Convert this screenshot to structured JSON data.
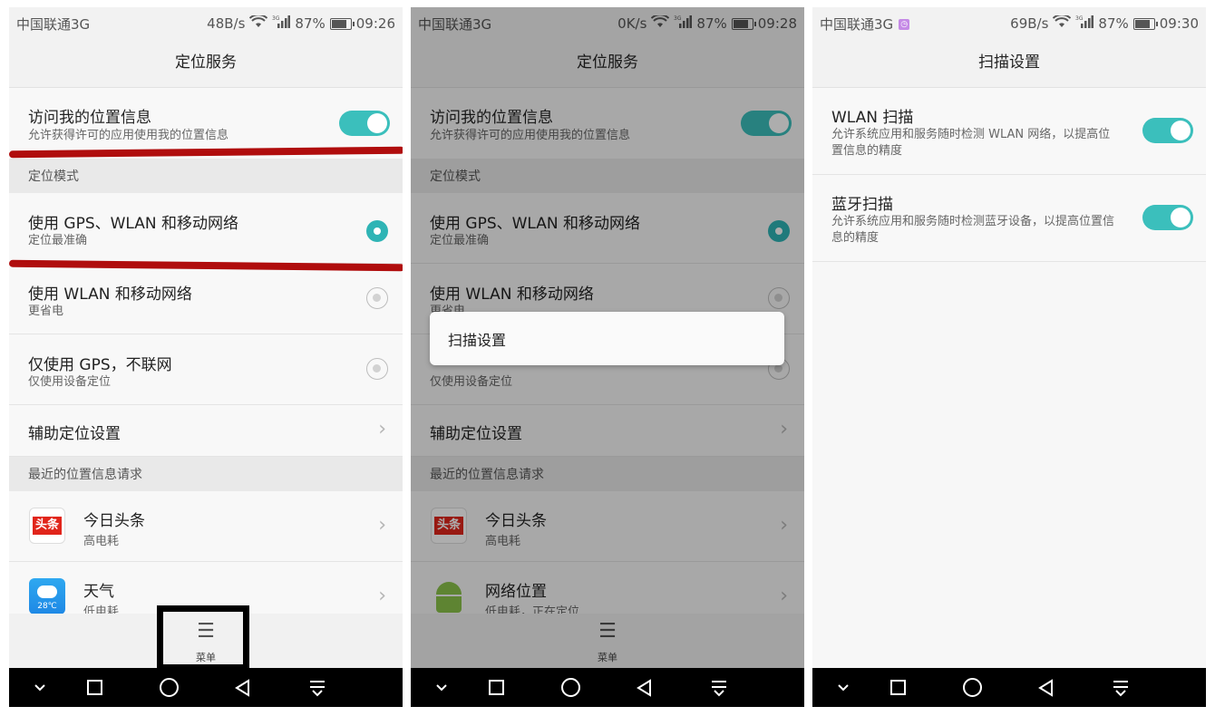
{
  "panel1": {
    "status": {
      "carrier": "中国联通3G",
      "speed": "48B/s",
      "battery": "87%",
      "time": "09:26"
    },
    "title": "定位服务",
    "access": {
      "title": "访问我的位置信息",
      "sub": "允许获得许可的应用使用我的位置信息"
    },
    "mode_section": "定位模式",
    "modes": [
      {
        "title": "使用 GPS、WLAN 和移动网络",
        "sub": "定位最准确"
      },
      {
        "title": "使用 WLAN 和移动网络",
        "sub": "更省电"
      },
      {
        "title": "仅使用 GPS，不联网",
        "sub": "仅使用设备定位"
      }
    ],
    "assist": "辅助定位设置",
    "recent_section": "最近的位置信息请求",
    "apps": [
      {
        "name": "今日头条",
        "sub": "高电耗",
        "icon_text": "头条"
      },
      {
        "name": "天气",
        "sub": "低电耗",
        "icon_text": "28℃"
      }
    ],
    "menu_label": "菜单"
  },
  "panel2": {
    "status": {
      "carrier": "中国联通3G",
      "speed": "0K/s",
      "battery": "87%",
      "time": "09:28"
    },
    "title": "定位服务",
    "access": {
      "title": "访问我的位置信息",
      "sub": "允许获得许可的应用使用我的位置信息"
    },
    "mode_section": "定位模式",
    "modes": [
      {
        "title": "使用 GPS、WLAN 和移动网络",
        "sub": "定位最准确"
      },
      {
        "title": "使用 WLAN 和移动网络",
        "sub": "更省电"
      },
      {
        "title": "",
        "sub": "仅使用设备定位"
      }
    ],
    "assist": "辅助定位设置",
    "recent_section": "最近的位置信息请求",
    "apps": [
      {
        "name": "今日头条",
        "sub": "高电耗",
        "icon_text": "头条"
      },
      {
        "name": "网络位置",
        "sub": "低电耗，正在定位"
      }
    ],
    "popup": "扫描设置",
    "menu_label": "菜单"
  },
  "panel3": {
    "status": {
      "carrier": "中国联通3G",
      "speed": "69B/s",
      "battery": "87%",
      "time": "09:30"
    },
    "title": "扫描设置",
    "items": [
      {
        "title": "WLAN 扫描",
        "sub1": "允许系统应用和服务随时检测 WLAN 网络，以提高位",
        "sub2": "置信息的精度"
      },
      {
        "title": "蓝牙扫描",
        "sub1": "允许系统应用和服务随时检测蓝牙设备，以提高位置信",
        "sub2": "息的精度"
      }
    ]
  },
  "colors": {
    "accent": "#3bbfbc",
    "annotation_red": "#b00d0d",
    "navbar": "#000000"
  }
}
